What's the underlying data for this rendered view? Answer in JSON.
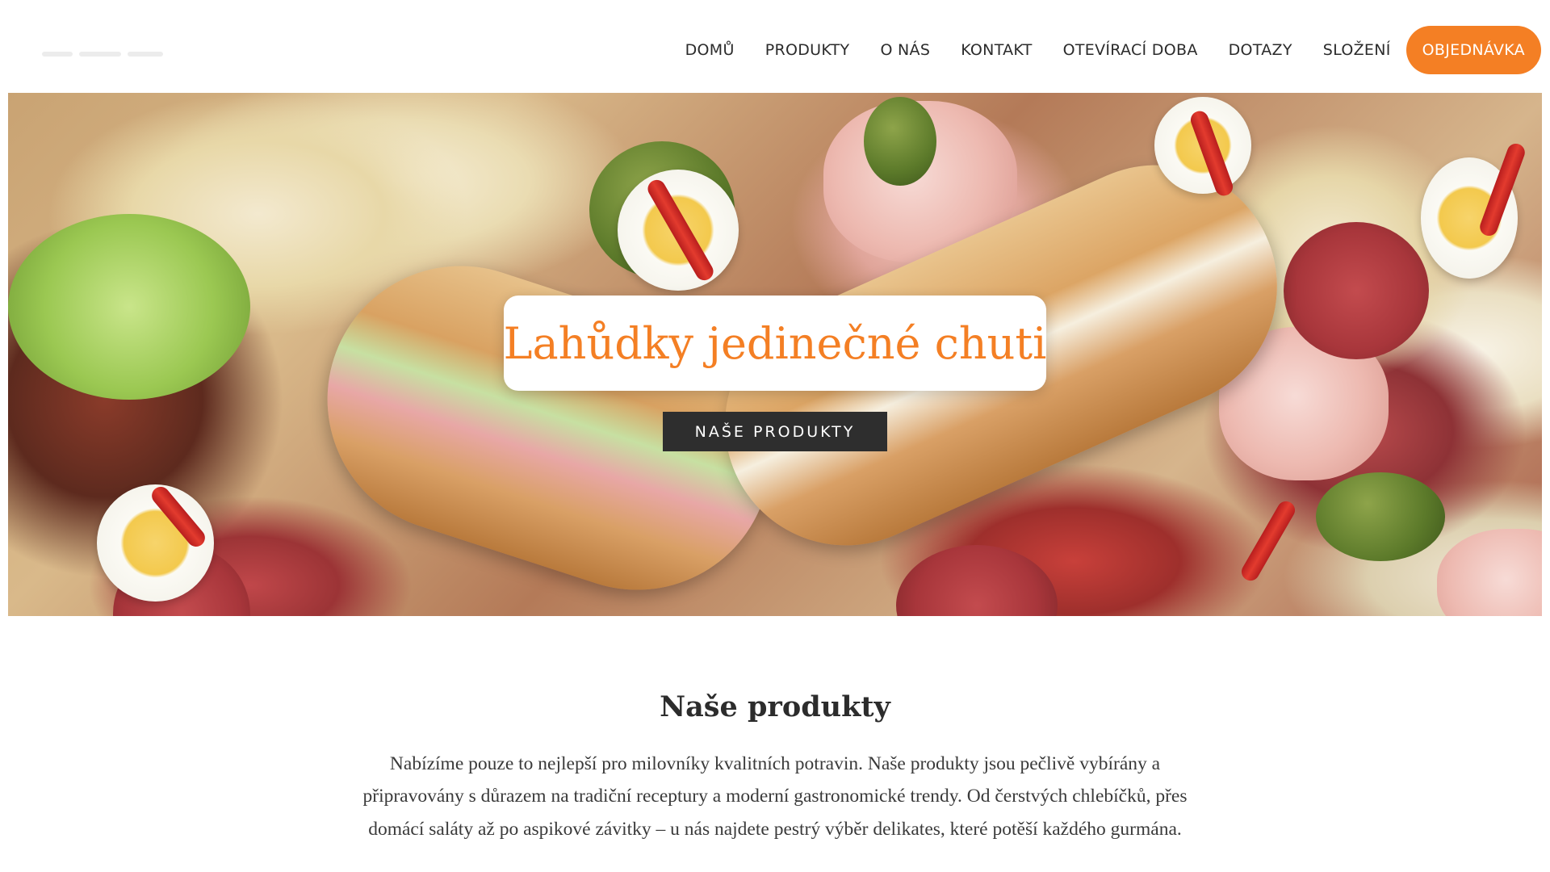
{
  "nav": {
    "items": [
      "DOMŮ",
      "PRODUKTY",
      "O NÁS",
      "KONTAKT",
      "OTEVÍRACÍ DOBA",
      "DOTAZY",
      "SLOŽENÍ"
    ],
    "cta_label": "OBJEDNÁVKA"
  },
  "hero": {
    "title": "Lahůdky jedinečné chuti",
    "button_label": "NAŠE PRODUKTY"
  },
  "products": {
    "title": "Naše produkty",
    "description": "Nabízíme pouze to nejlepší pro milovníky kvalitních potravin. Naše produkty jsou pečlivě vybírány a připravovány s důrazem na tradiční receptury a moderní gastronomické trendy. Od čerstvých chlebíčků, přes domácí saláty až po aspikové závitky – u nás najdete pestrý výběr delikates, které potěší každého gurmána."
  },
  "colors": {
    "accent": "#f47f24",
    "dark_button": "#2e2e2e",
    "text": "#2c2c2c"
  }
}
